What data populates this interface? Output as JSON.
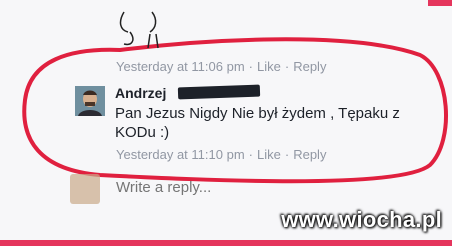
{
  "top_comment_meta": {
    "time": "Yesterday at 11:06 pm",
    "sep": "·",
    "like": "Like",
    "reply": "Reply"
  },
  "comment": {
    "author": "Andrzej",
    "text": "Pan Jezus Nigdy Nie był żydem , Tępaku z KODu :)",
    "time": "Yesterday at 11:10 pm",
    "like": "Like",
    "reply": "Reply"
  },
  "reply_box": {
    "placeholder": "Write a reply..."
  },
  "watermark": "www.wiocha.pl",
  "colors": {
    "annotation": "#e0203f",
    "meta": "#9197a3",
    "brand_bar": "#e5355d"
  }
}
